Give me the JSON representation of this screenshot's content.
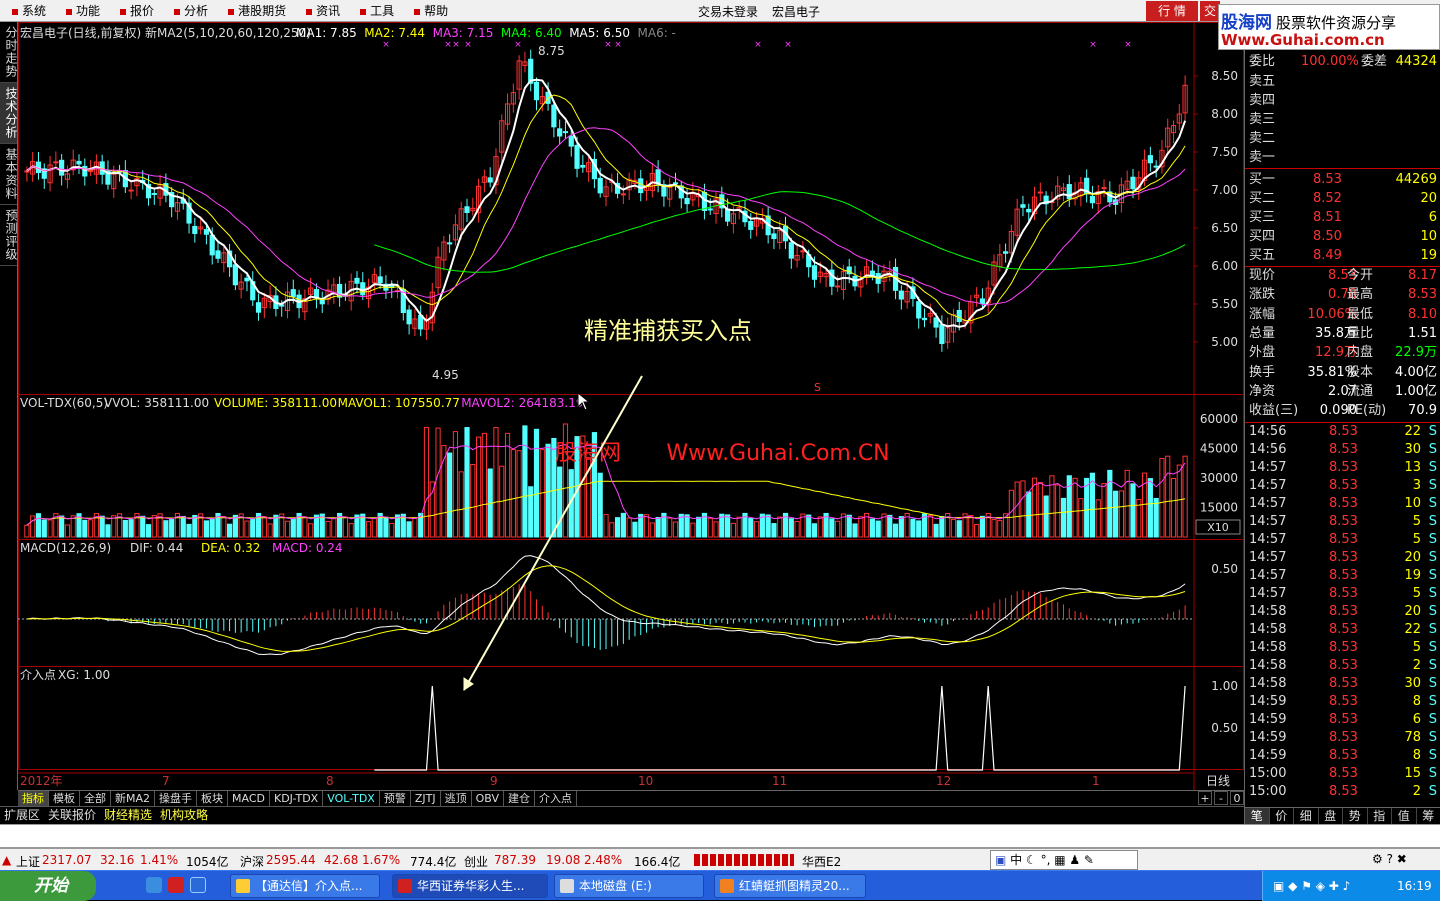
{
  "menu": [
    "系统",
    "功能",
    "报价",
    "分析",
    "港股期货",
    "资讯",
    "工具",
    "帮助"
  ],
  "menu_center": [
    "交易未登录",
    "宏昌电子"
  ],
  "menu_right": {
    "hq": "行 情",
    "jy": "交"
  },
  "logo": {
    "line1a": "股海网",
    "line1b": "股票软件资源分享",
    "line2": "Www.Guhai.com.cn"
  },
  "side_tabs": [
    "分时走势",
    "技术分析",
    "基本资料",
    "预测评级"
  ],
  "price_chart": {
    "title": "宏昌电子(日线,前复权) 新MA2(5,10,20,60,120,250)",
    "ma": [
      {
        "label": "MA1: 7.85",
        "color": "#ffffff"
      },
      {
        "label": "MA2: 7.44",
        "color": "#ffff00"
      },
      {
        "label": "MA3: 7.15",
        "color": "#ff40ff"
      },
      {
        "label": "MA4: 6.40",
        "color": "#00ff00"
      },
      {
        "label": "MA5: 6.50",
        "color": "#ffffff"
      },
      {
        "label": "MA6: -",
        "color": "#888888"
      }
    ],
    "high_label": "8.75",
    "low_label": "4.95",
    "yticks": [
      "8.50",
      "8.00",
      "7.50",
      "7.00",
      "6.50",
      "6.00",
      "5.50",
      "5.00"
    ],
    "annotation": "精准捕获买入点",
    "s_marker": "S"
  },
  "volume_chart": {
    "title": "VOL-TDX(60,5)",
    "labels": [
      {
        "t": "VVOL: 358111.00",
        "c": "#dddddd"
      },
      {
        "t": "VOLUME: 358111.00",
        "c": "#ffff00"
      },
      {
        "t": "MAVOL1: 107550.77",
        "c": "#ffff00"
      },
      {
        "t": "MAVOL2: 264183.19",
        "c": "#ff40ff"
      }
    ],
    "yticks": [
      "60000",
      "45000",
      "30000",
      "15000"
    ],
    "unit": "X10",
    "watermark_a": "股海网",
    "watermark_b": "Www.Guhai.Com.CN"
  },
  "macd_chart": {
    "title": "MACD(12,26,9)",
    "labels": [
      {
        "t": "DIF: 0.44",
        "c": "#dddddd"
      },
      {
        "t": "DEA: 0.32",
        "c": "#ffff00"
      },
      {
        "t": "MACD: 0.24",
        "c": "#ff40ff"
      }
    ],
    "yticks": [
      "0.50"
    ]
  },
  "xg_chart": {
    "title": "介入点",
    "label": "XG: 1.00",
    "yticks": [
      "1.00",
      "0.50"
    ]
  },
  "xaxis": {
    "labels": [
      "2012年",
      "7",
      "8",
      "9",
      "10",
      "11",
      "12",
      "1"
    ],
    "period": "日线"
  },
  "bottom_tabs": [
    "指标",
    "模板",
    "全部",
    "新MA2",
    "操盘手",
    "板块",
    "MACD",
    "KDJ-TDX",
    "VOL-TDX",
    "预警",
    "ZJTJ",
    "逃顶",
    "OBV",
    "建仓",
    "介入点"
  ],
  "bottom_right": [
    "+",
    "-",
    "0"
  ],
  "ext_tabs": [
    "扩展区",
    "关联报价",
    "财经精选",
    "机构攻略"
  ],
  "order_book": {
    "header": {
      "l": "委比",
      "v": "100.00%",
      "l2": "委差",
      "v2": "44324"
    },
    "sell": [
      "卖五",
      "卖四",
      "卖三",
      "卖二",
      "卖一"
    ],
    "buy": [
      {
        "l": "买一",
        "p": "8.53",
        "v": "44269"
      },
      {
        "l": "买二",
        "p": "8.52",
        "v": "20"
      },
      {
        "l": "买三",
        "p": "8.51",
        "v": "6"
      },
      {
        "l": "买四",
        "p": "8.50",
        "v": "10"
      },
      {
        "l": "买五",
        "p": "8.49",
        "v": "19"
      }
    ]
  },
  "quote": [
    {
      "a": "现价",
      "av": "8.53",
      "b": "今开",
      "bv": "8.17"
    },
    {
      "a": "涨跌",
      "av": "0.78",
      "b": "最高",
      "bv": "8.53"
    },
    {
      "a": "涨幅",
      "av": "10.06%",
      "b": "最低",
      "bv": "8.10"
    },
    {
      "a": "总量",
      "av": "35.8万",
      "b": "量比",
      "bv": "1.51"
    },
    {
      "a": "外盘",
      "av": "12.9万",
      "b": "内盘",
      "bv": "22.9万"
    },
    {
      "a": "换手",
      "av": "35.81%",
      "b": "股本",
      "bv": "4.00亿"
    },
    {
      "a": "净资",
      "av": "2.07",
      "b": "流通",
      "bv": "1.00亿"
    },
    {
      "a": "收益(三)",
      "av": "0.090",
      "b": "PE(动)",
      "bv": "70.9"
    }
  ],
  "ticks": [
    [
      "14:56",
      "8.53",
      "22"
    ],
    [
      "14:56",
      "8.53",
      "30"
    ],
    [
      "14:57",
      "8.53",
      "13"
    ],
    [
      "14:57",
      "8.53",
      "3"
    ],
    [
      "14:57",
      "8.53",
      "10"
    ],
    [
      "14:57",
      "8.53",
      "5"
    ],
    [
      "14:57",
      "8.53",
      "5"
    ],
    [
      "14:57",
      "8.53",
      "20"
    ],
    [
      "14:57",
      "8.53",
      "19"
    ],
    [
      "14:57",
      "8.53",
      "5"
    ],
    [
      "14:58",
      "8.53",
      "20"
    ],
    [
      "14:58",
      "8.53",
      "22"
    ],
    [
      "14:58",
      "8.53",
      "5"
    ],
    [
      "14:58",
      "8.53",
      "2"
    ],
    [
      "14:58",
      "8.53",
      "30"
    ],
    [
      "14:59",
      "8.53",
      "8"
    ],
    [
      "14:59",
      "8.53",
      "6"
    ],
    [
      "14:59",
      "8.53",
      "78"
    ],
    [
      "14:59",
      "8.53",
      "8"
    ],
    [
      "15:00",
      "8.53",
      "15"
    ],
    [
      "15:00",
      "8.53",
      "2"
    ]
  ],
  "tick_flag": "S",
  "panel_tabs": [
    "笔",
    "价",
    "细",
    "盘",
    "势",
    "指",
    "值",
    "筹"
  ],
  "status": {
    "sh": {
      "n": "上证",
      "p": "2317.07",
      "c": "32.16",
      "pct": "1.41%",
      "amt": "1054亿"
    },
    "hs": {
      "n": "沪深",
      "p": "2595.44",
      "c": "42.68",
      "pct": "1.67%",
      "amt": "774.4亿"
    },
    "cy": {
      "n": "创业",
      "p": "787.39",
      "c": "19.08",
      "pct": "2.48%",
      "amt": "166.4亿"
    },
    "broker": "华西E2",
    "ime": "中"
  },
  "taskbar": {
    "start": "开始",
    "items": [
      "【通达信】介入点...",
      "华西证券华彩人生...",
      "本地磁盘 (E:)",
      "红蜻蜓抓图精灵20..."
    ],
    "clock": "16:19"
  },
  "colors": {
    "up": "#ff3232",
    "down": "#54ffff",
    "ma1": "#ffffff",
    "ma2": "#ffff00",
    "ma3": "#ff40ff",
    "ma4": "#00ff00"
  }
}
